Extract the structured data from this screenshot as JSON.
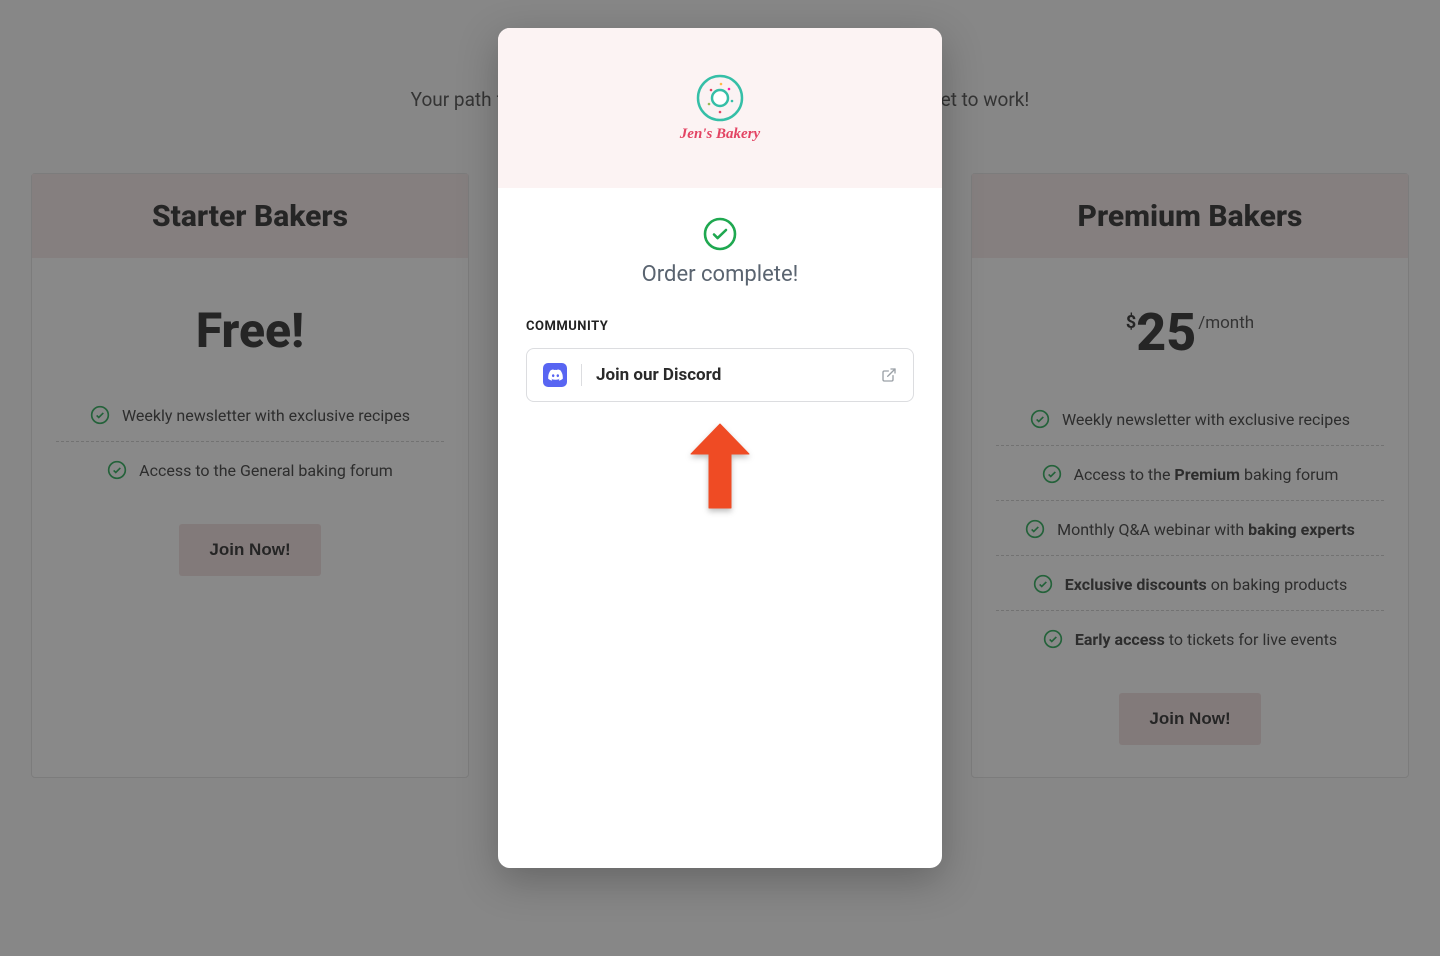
{
  "page": {
    "subtitle": "Your path from home baker to professional starts here — let's get to work!"
  },
  "plans": {
    "starter": {
      "title": "Starter Bakers",
      "price_label": "Free!",
      "features": [
        "Weekly newsletter with exclusive recipes",
        "Access to the General baking forum"
      ],
      "cta": "Join Now!"
    },
    "premium": {
      "title": "Premium Bakers",
      "currency": "$",
      "amount": "25",
      "per": "/month",
      "features": [
        {
          "text": "Weekly newsletter with exclusive recipes"
        },
        {
          "pre": "Access to the ",
          "bold": "Premium",
          "post": " baking forum"
        },
        {
          "pre": "Monthly Q&A webinar with ",
          "bold": "baking experts",
          "post": ""
        },
        {
          "pre": "",
          "bold": "Exclusive discounts",
          "post": " on baking products"
        },
        {
          "pre": "",
          "bold": "Early access",
          "post": " to tickets for live events"
        }
      ],
      "cta": "Join Now!"
    }
  },
  "modal": {
    "brand_name": "Jen's Bakery",
    "order_complete": "Order complete!",
    "section_label": "COMMUNITY",
    "community_link": "Join our Discord"
  },
  "colors": {
    "accent_green": "#1fa850",
    "arrow": "#ef4b24",
    "discord": "#5865F2",
    "brand_pink": "#e34463"
  }
}
